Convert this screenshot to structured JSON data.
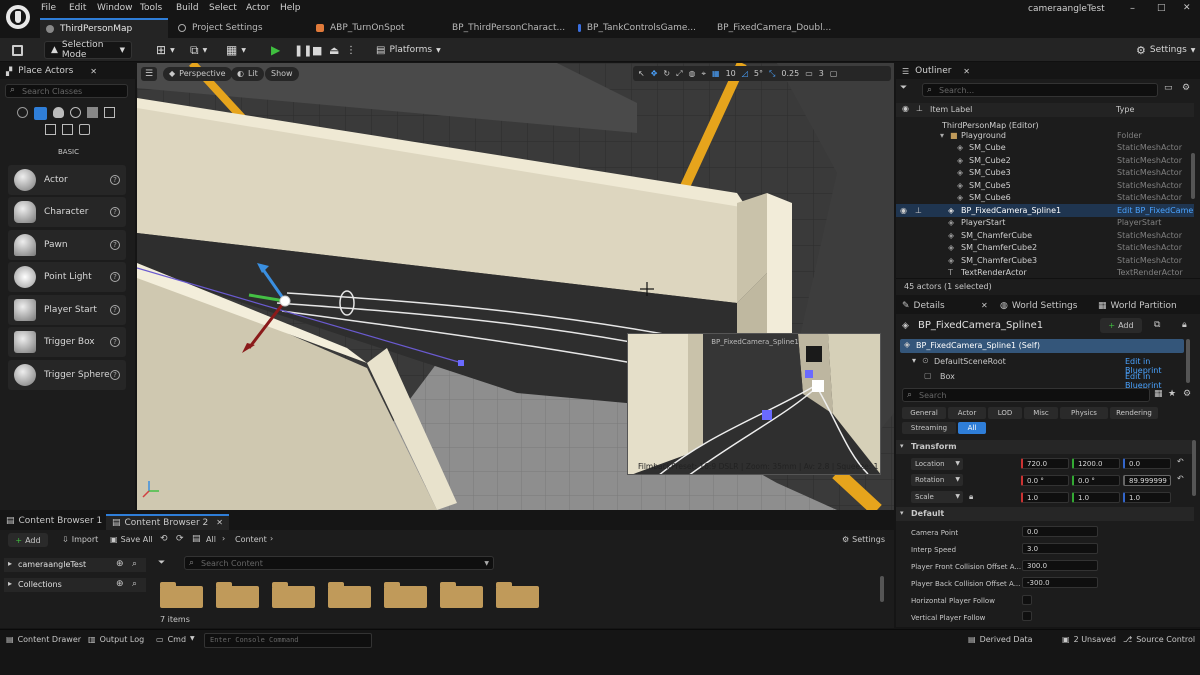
{
  "menu": [
    "File",
    "Edit",
    "Window",
    "Tools",
    "Build",
    "Select",
    "Actor",
    "Help"
  ],
  "project_name": "cameraangleTest",
  "window_controls": {
    "minimize": "–",
    "maximize": "□",
    "close": "✕"
  },
  "doc_tabs": [
    {
      "label": "ThirdPersonMap",
      "active": true
    },
    {
      "label": "Project Settings"
    },
    {
      "label": "ABP_TurnOnSpot"
    },
    {
      "label": "BP_ThirdPersonCharact..."
    },
    {
      "label": "BP_TankControlsGame..."
    },
    {
      "label": "BP_FixedCamera_Doubl..."
    }
  ],
  "toolbar": {
    "selection_mode": "Selection Mode",
    "platforms": "Platforms",
    "settings": "Settings"
  },
  "place_actors": {
    "tab_label": "Place Actors",
    "search_placeholder": "Search Classes",
    "category": "BASIC",
    "items": [
      "Actor",
      "Character",
      "Pawn",
      "Point Light",
      "Player Start",
      "Trigger Box",
      "Trigger Sphere"
    ]
  },
  "viewport": {
    "perspective": "Perspective",
    "lit": "Lit",
    "show": "Show",
    "grid_snap": "10",
    "rot_snap": "5°",
    "scale_snap": "0.25",
    "camera_speed": "3",
    "pip_title": "BP_FixedCamera_Spline1",
    "pip_footer": "FilmbackPreset: 16:9 DSLR | Zoom: 35mm | Av: 2.8 | Squeeze: 1"
  },
  "outliner": {
    "tab_label": "Outliner",
    "search_placeholder": "Search...",
    "col_label": "Item Label",
    "col_type": "Type",
    "rows": [
      {
        "name": "ThirdPersonMap (Editor)",
        "type": ""
      },
      {
        "name": "Playground",
        "type": "Folder"
      },
      {
        "name": "SM_Cube",
        "type": "StaticMeshActor"
      },
      {
        "name": "SM_Cube2",
        "type": "StaticMeshActor"
      },
      {
        "name": "SM_Cube3",
        "type": "StaticMeshActor"
      },
      {
        "name": "SM_Cube5",
        "type": "StaticMeshActor"
      },
      {
        "name": "SM_Cube6",
        "type": "StaticMeshActor"
      },
      {
        "name": "BP_FixedCamera_Spline1",
        "type": "Edit BP_FixedCame"
      },
      {
        "name": "PlayerStart",
        "type": "PlayerStart"
      },
      {
        "name": "SM_ChamferCube",
        "type": "StaticMeshActor"
      },
      {
        "name": "SM_ChamferCube2",
        "type": "StaticMeshActor"
      },
      {
        "name": "SM_ChamferCube3",
        "type": "StaticMeshActor"
      },
      {
        "name": "TextRenderActor",
        "type": "TextRenderActor"
      }
    ],
    "status": "45 actors (1 selected)"
  },
  "details": {
    "tabs": [
      "Details",
      "World Settings",
      "World Partition"
    ],
    "actor_name": "BP_FixedCamera_Spline1",
    "add_label": "Add",
    "components": [
      {
        "name": "BP_FixedCamera_Spline1 (Self)",
        "link": ""
      },
      {
        "name": "DefaultSceneRoot",
        "link": "Edit in Blueprint"
      },
      {
        "name": "Box",
        "link": "Edit in Blueprint"
      }
    ],
    "search_placeholder": "Search",
    "categories": [
      "General",
      "Actor",
      "LOD",
      "Misc",
      "Physics",
      "Rendering",
      "Streaming",
      "All"
    ],
    "transform_header": "Transform",
    "location": {
      "label": "Location",
      "x": "720.0",
      "y": "1200.0",
      "z": "0.0"
    },
    "rotation": {
      "label": "Rotation",
      "x": "0.0 °",
      "y": "0.0 °",
      "z": "89.999999 °"
    },
    "scale": {
      "label": "Scale",
      "x": "1.0",
      "y": "1.0",
      "z": "1.0"
    },
    "default_header": "Default",
    "props": [
      {
        "label": "Camera Point",
        "value": "0.0"
      },
      {
        "label": "Interp Speed",
        "value": "3.0"
      },
      {
        "label": "Player Front Collision Offset A...",
        "value": "300.0"
      },
      {
        "label": "Player Back Collision Offset A...",
        "value": "-300.0"
      },
      {
        "label": "Horizontal Player Follow",
        "value": ""
      },
      {
        "label": "Vertical Player Follow",
        "value": ""
      }
    ]
  },
  "content_browser": {
    "tabs": [
      "Content Browser 1",
      "Content Browser 2"
    ],
    "add": "Add",
    "import": "Import",
    "save_all": "Save All",
    "path_root": "All",
    "path_folder": "Content",
    "settings": "Settings",
    "project": "cameraangleTest",
    "collections": "Collections",
    "search_placeholder": "Search Content",
    "item_count": "7 items",
    "folder_count": 7
  },
  "status_bar": {
    "content_drawer": "Content Drawer",
    "output_log": "Output Log",
    "cmd": "Cmd",
    "console_placeholder": "Enter Console Command",
    "derived_data": "Derived Data",
    "unsaved": "2 Unsaved",
    "source_control": "Source Control"
  },
  "colors": {
    "accent": "#2f7ed8",
    "selection": "#1f3550",
    "play": "#3fbf3f",
    "folder": "#c09a5a"
  }
}
